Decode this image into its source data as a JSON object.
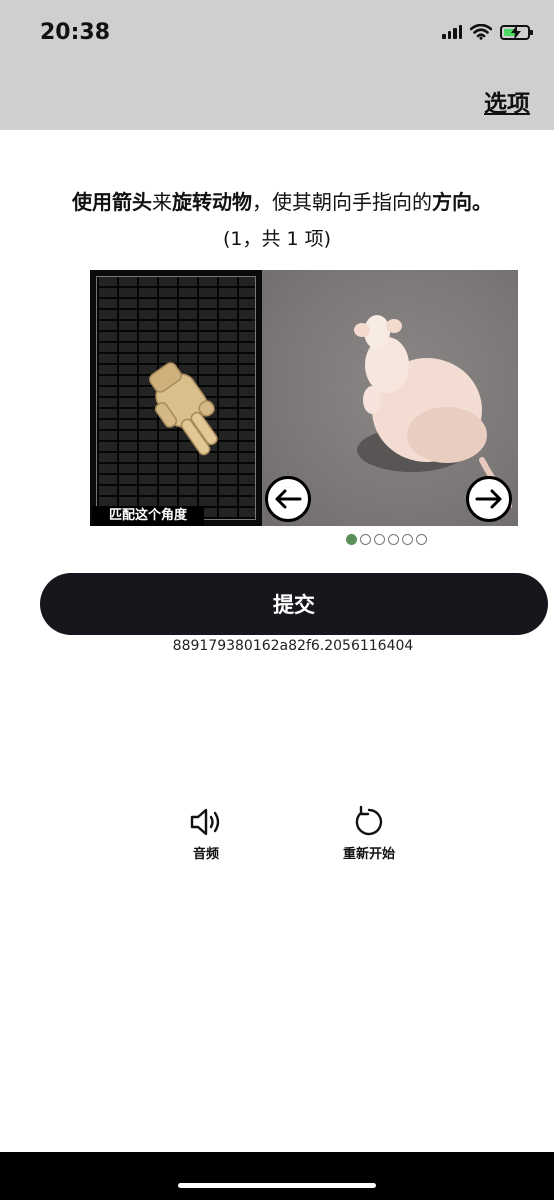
{
  "status_bar": {
    "time": "20:38",
    "icons": [
      "signal-icon",
      "wifi-icon",
      "battery-charging-icon"
    ],
    "battery_color": "#4cd964"
  },
  "header": {
    "options_label": "选项"
  },
  "instruction": {
    "parts": [
      {
        "text": "使用",
        "bold": true
      },
      {
        "text": "箭头",
        "bold": true
      },
      {
        "text": "来",
        "bold": false
      },
      {
        "text": "旋转动物",
        "bold": true
      },
      {
        "text": "，使其朝向手指向的",
        "bold": false
      },
      {
        "text": "方向",
        "bold": true
      },
      {
        "text": "。",
        "bold": true
      }
    ],
    "count": "(1，共 1 项)"
  },
  "puzzle": {
    "reference_label": "匹配这个角度",
    "left_arrow": "←",
    "right_arrow": "→",
    "pager": {
      "total": 6,
      "active_index": 0,
      "active_color": "#5a8f5a"
    }
  },
  "submit": {
    "label": "提交",
    "color": "#16171c"
  },
  "session_id": "889179380162a82f6.2056116404",
  "tools": {
    "audio_label": "音频",
    "restart_label": "重新开始"
  }
}
